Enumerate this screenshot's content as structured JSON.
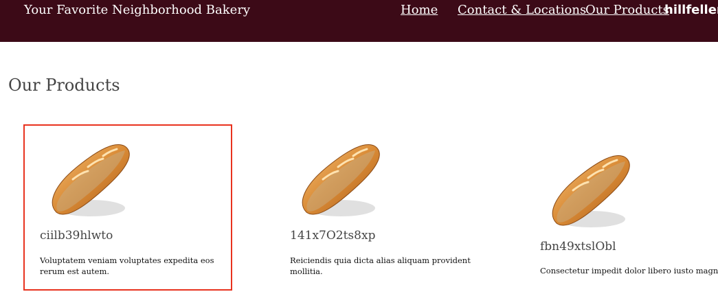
{
  "header": {
    "brand": "Your Favorite Neighborhood Bakery",
    "nav": {
      "home": "Home",
      "contact": "Contact & Locations",
      "products": "Our Products"
    },
    "user": "hillfeller@"
  },
  "main": {
    "title": "Our Products",
    "products": [
      {
        "name": "ciilb39hlwto",
        "description": "Voluptatem veniam voluptates expedita eos rerum est autem.",
        "image": "baguette-image"
      },
      {
        "name": "141x7O2ts8xp",
        "description": "Reiciendis quia dicta alias aliquam provident mollitia.",
        "image": "baguette-image"
      },
      {
        "name": "fbn49xtslObl",
        "description": "Consectetur impedit dolor libero iusto magni.",
        "image": "baguette-image"
      }
    ]
  },
  "colors": {
    "header_bg": "#3c0a17",
    "selection_outline": "#e8321e"
  }
}
